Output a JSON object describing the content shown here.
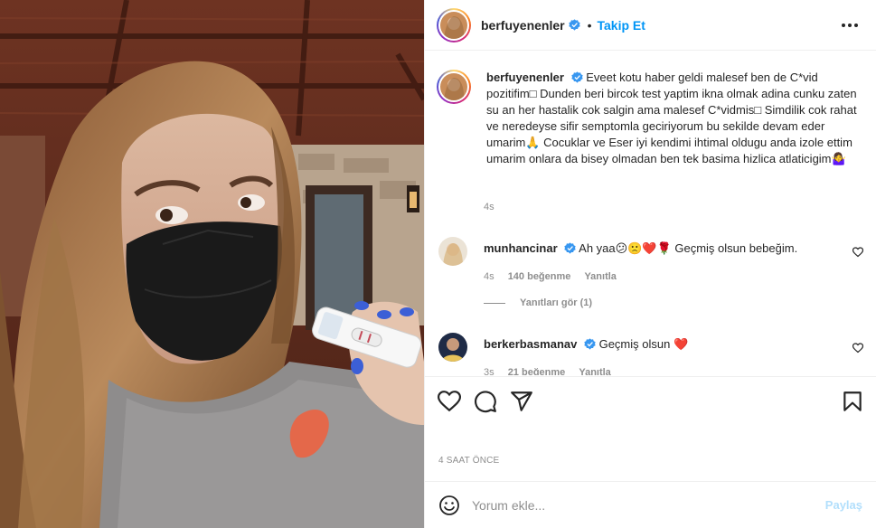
{
  "post": {
    "username": "berfuyenenler",
    "follow_label": "Takip Et",
    "separator": "•",
    "caption": "Eveet kotu haber geldi malesef ben de C*vid pozitifim□ Dunden beri bircok test yaptim ikna olmak adina cunku zaten su an her hastalik cok salgin ama malesef C*vidmis□ Simdilik cok rahat ve neredeyse sifir semptomla geciriyorum bu sekilde devam eder umarim🙏 Cocuklar ve Eser iyi kendimi ihtimal oldugu anda izole ettim umarim onlara da bisey olmadan ben tek basima hizlica atlaticigim🤷‍♀️",
    "caption_time": "4s",
    "date": "4 SAAT ÖNCE"
  },
  "comments": [
    {
      "username": "munhancinar",
      "text": "Ah yaa😕🙁❤️🌹 Geçmiş olsun bebeğim.",
      "time": "4s",
      "likes": "140 beğenme",
      "reply_label": "Yanıtla"
    },
    {
      "username": "berkerbasmanav",
      "text": "Geçmiş olsun ❤️",
      "time": "3s",
      "likes": "21 beğenme",
      "reply_label": "Yanıtla"
    }
  ],
  "view_replies": "Yanıtları gör (1)",
  "composer": {
    "placeholder": "Yorum ekle...",
    "post_label": "Paylaş"
  },
  "icons": {
    "like": "heart-icon",
    "comment": "comment-icon",
    "share": "paper-plane-icon",
    "save": "bookmark-icon",
    "more": "more-options-icon",
    "emoji": "emoji-icon",
    "verified": "verified-badge-icon"
  },
  "colors": {
    "accent": "#0095f6",
    "verified": "#3897f0",
    "muted": "#8e8e8e",
    "post_disabled": "#b2dffc"
  }
}
